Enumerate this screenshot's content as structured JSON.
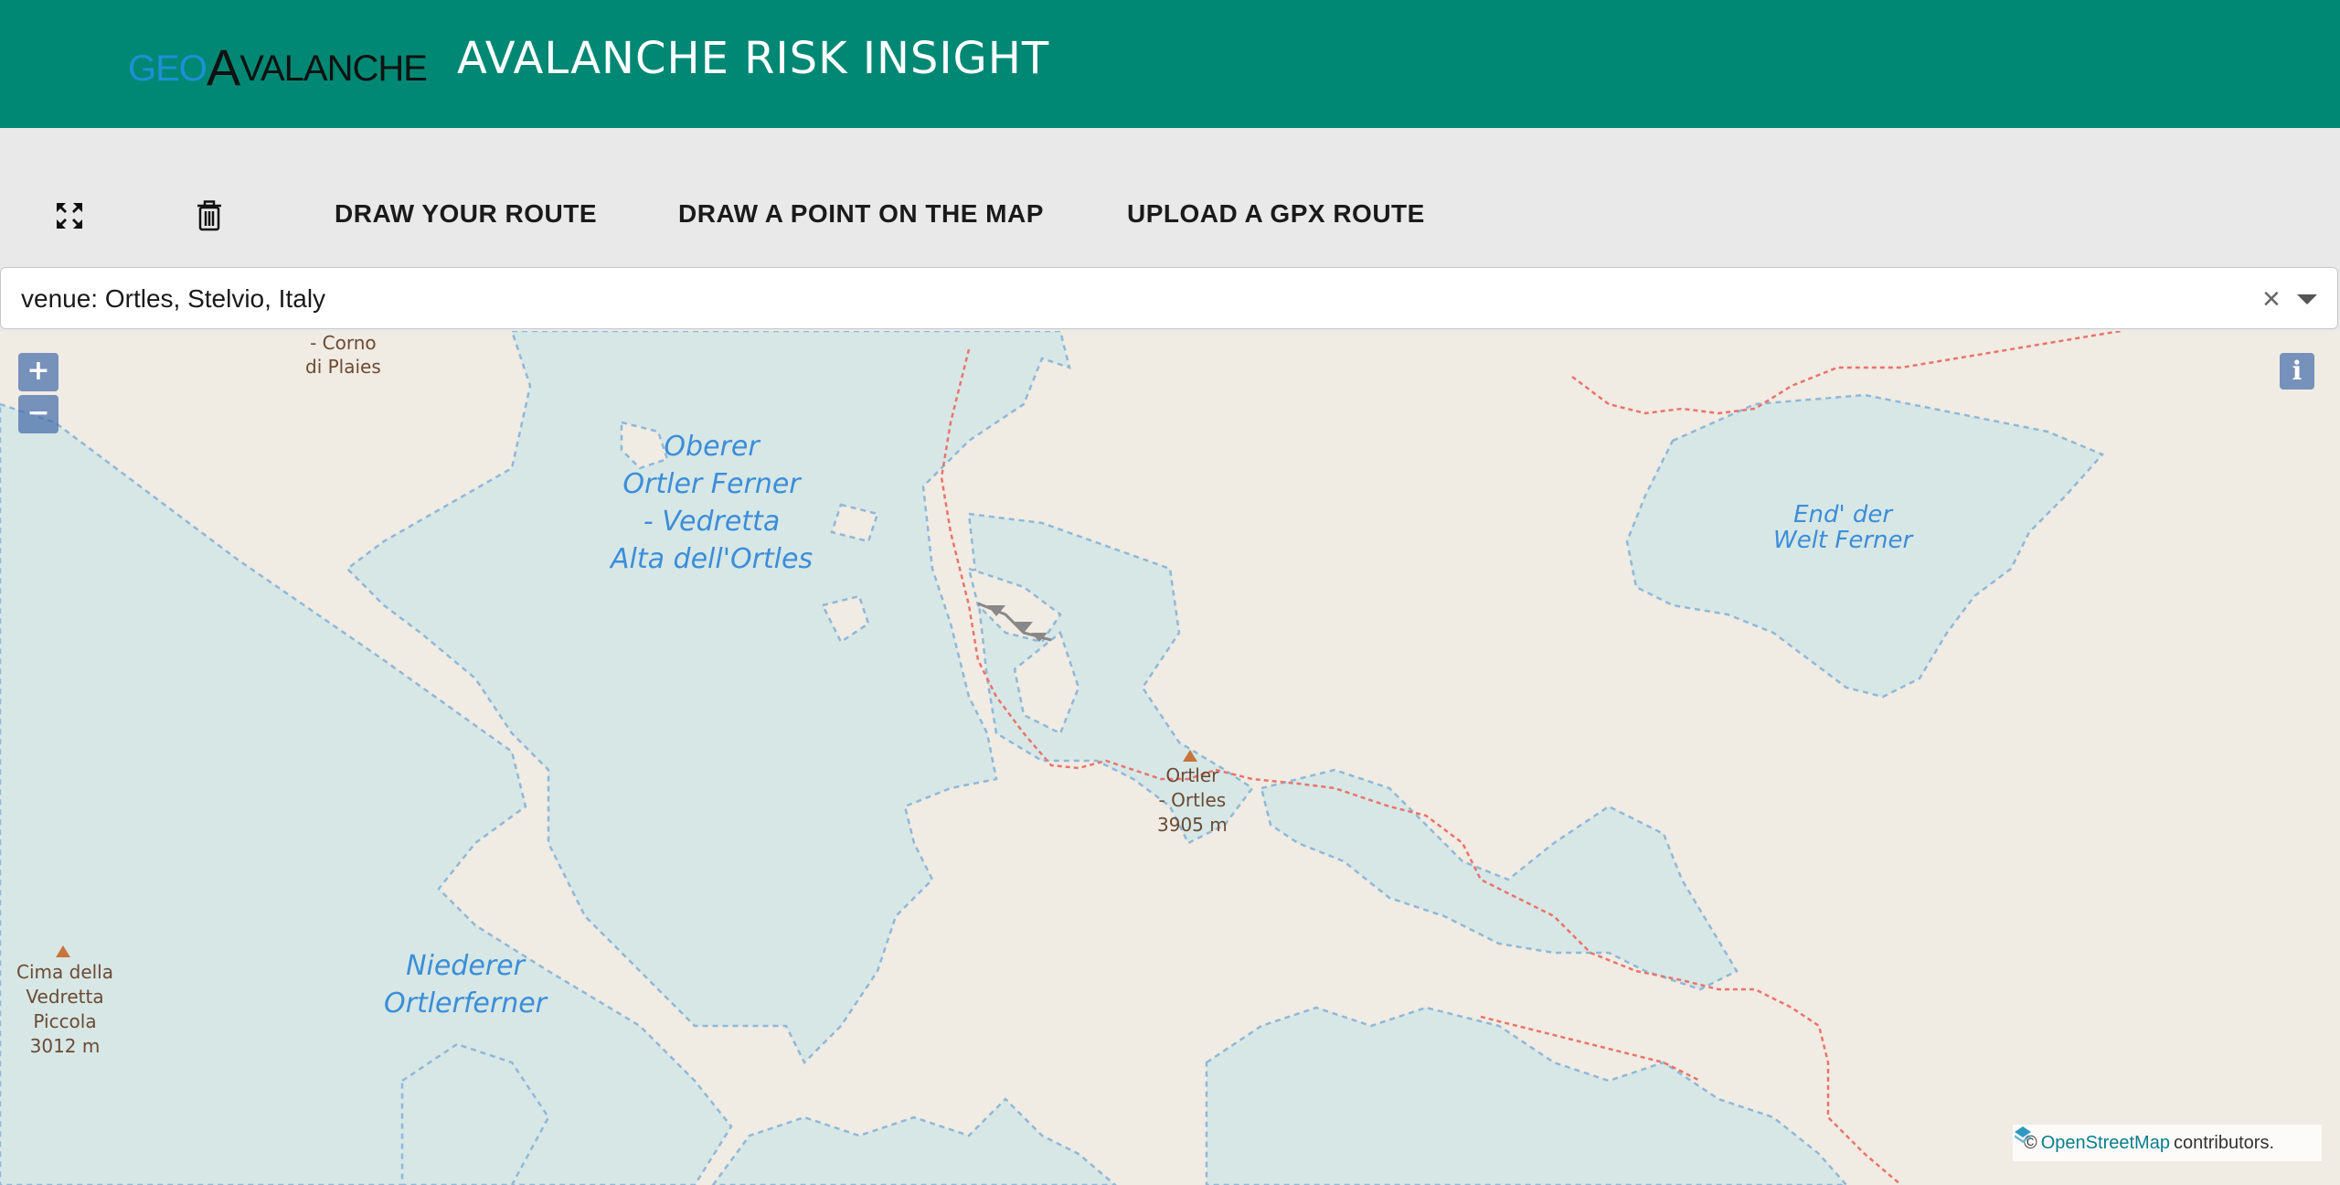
{
  "header": {
    "logo_geo": "GEO",
    "logo_a": "A",
    "logo_rest": "VALANCHE",
    "app_title": "AVALANCHE RISK INSIGHT"
  },
  "toolbar": {
    "fullscreen_icon": "expand-arrows-icon",
    "delete_icon": "trash-icon",
    "draw_route_label": "DRAW YOUR ROUTE",
    "draw_point_label": "DRAW A POINT ON THE MAP",
    "upload_gpx_label": "UPLOAD A GPX ROUTE"
  },
  "search": {
    "value": "venue: Ortles, Stelvio, Italy",
    "clear_glyph": "×"
  },
  "map": {
    "zoom_in": "+",
    "zoom_out": "−",
    "info": "i",
    "labels": {
      "oberer": [
        "Oberer",
        "Ortler Ferner",
        "- Vedretta",
        "Alta dell'Ortles"
      ],
      "niederer": [
        "Niederer",
        "Ortlerferner"
      ],
      "end_der": [
        "End' der",
        "Welt Ferner"
      ],
      "ortler": [
        "Ortler",
        "- Ortles",
        "3905 m"
      ],
      "cima": [
        "Cima della",
        "Vedretta",
        "Piccola",
        "3012 m"
      ],
      "corno": [
        "- Corno",
        "di Plaies"
      ]
    },
    "attribution": {
      "prefix": "©",
      "link": "OpenStreetMap",
      "suffix": "contributors."
    },
    "colors": {
      "land": "#f0ebe3",
      "glacier": "#d7e7e6",
      "glacier_edge": "#8fb8d8",
      "trail": "#e9746c",
      "label_blue": "#3b8ed8",
      "peak": "#c8743a"
    }
  },
  "colors": {
    "header_bg": "#008874",
    "toolbar_bg": "#e9e9e9"
  }
}
